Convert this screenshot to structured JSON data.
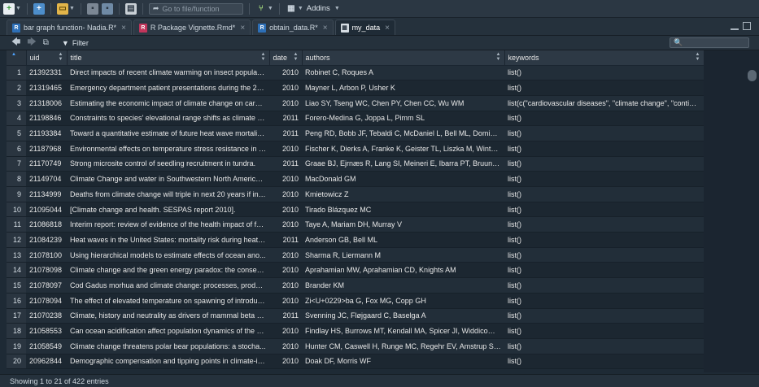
{
  "toolbar": {
    "goto_placeholder": "Go to file/function",
    "addins_label": "Addins"
  },
  "tabs": [
    {
      "label": "bar graph function- Nadia.R*",
      "icon": "r-script-icon",
      "active": false
    },
    {
      "label": "R Package Vignette.Rmd*",
      "icon": "rmarkdown-icon",
      "active": false
    },
    {
      "label": "obtain_data.R*",
      "icon": "r-script-icon",
      "active": false
    },
    {
      "label": "my_data",
      "icon": "table-icon",
      "active": true
    }
  ],
  "viewer": {
    "filter_label": "Filter",
    "search_placeholder": ""
  },
  "columns": [
    "uid",
    "title",
    "date",
    "authors",
    "keywords"
  ],
  "rows": [
    {
      "n": "1",
      "uid": "21392331",
      "title": "Direct impacts of recent climate warming on insect populati...",
      "date": "2010",
      "authors": "Robinet C, Roques A",
      "keywords": "list()"
    },
    {
      "n": "2",
      "uid": "21319465",
      "title": "Emergency department patient presentations during the 20...",
      "date": "2010",
      "authors": "Mayner L, Arbon P, Usher K",
      "keywords": "list()"
    },
    {
      "n": "3",
      "uid": "21318006",
      "title": "Estimating the economic impact of climate change on cardi...",
      "date": "2010",
      "authors": "Liao SY, Tseng WC, Chen PY, Chen CC, Wu WM",
      "keywords": "list(c(\"cardiovascular diseases\", \"climate change\", \"contingen..."
    },
    {
      "n": "4",
      "uid": "21198846",
      "title": "Constraints to species' elevational range shifts as climate ch...",
      "date": "2011",
      "authors": "Forero-Medina G, Joppa L, Pimm SL",
      "keywords": "list()"
    },
    {
      "n": "5",
      "uid": "21193384",
      "title": "Toward a quantitative estimate of future heat wave mortality...",
      "date": "2011",
      "authors": "Peng RD, Bobb JF, Tebaldi C, McDaniel L, Bell ML, Dominici F",
      "keywords": "list()"
    },
    {
      "n": "6",
      "uid": "21187968",
      "title": "Environmental effects on temperature stress resistance in th...",
      "date": "2010",
      "authors": "Fischer K, Dierks A, Franke K, Geister TL, Liszka M, Winter S, ...",
      "keywords": "list()"
    },
    {
      "n": "7",
      "uid": "21170749",
      "title": "Strong microsite control of seedling recruitment in tundra.",
      "date": "2011",
      "authors": "Graae BJ, Ejrnæs R, Lang SI, Meineri E, Ibarra PT, Bruun HH",
      "keywords": "list()"
    },
    {
      "n": "8",
      "uid": "21149704",
      "title": "Climate Change and water in Southwestern North America s...",
      "date": "2010",
      "authors": "MacDonald GM",
      "keywords": "list()"
    },
    {
      "n": "9",
      "uid": "21134999",
      "title": "Deaths from climate change will triple in next 20 years if ina...",
      "date": "2010",
      "authors": "Kmietowicz Z",
      "keywords": "list()"
    },
    {
      "n": "10",
      "uid": "21095044",
      "title": "[Climate change and health. SESPAS report 2010].",
      "date": "2010",
      "authors": "Tirado Blázquez MC",
      "keywords": "list()"
    },
    {
      "n": "11",
      "uid": "21086818",
      "title": "Interim report: review of evidence of the health impact of fa...",
      "date": "2010",
      "authors": "Taye A, Mariam DH, Murray V",
      "keywords": "list()"
    },
    {
      "n": "12",
      "uid": "21084239",
      "title": "Heat waves in the United States: mortality risk during heat w...",
      "date": "2011",
      "authors": "Anderson GB, Bell ML",
      "keywords": "list()"
    },
    {
      "n": "13",
      "uid": "21078100",
      "title": "Using hierarchical models to estimate effects of ocean ano...",
      "date": "2010",
      "authors": "Sharma R, Liermann M",
      "keywords": "list()"
    },
    {
      "n": "14",
      "uid": "21078098",
      "title": "Climate change and the green energy paradox: the consequ...",
      "date": "2010",
      "authors": "Aprahamian MW, Aprahamian CD, Knights AM",
      "keywords": "list()"
    },
    {
      "n": "15",
      "uid": "21078097",
      "title": "Cod Gadus morhua and climate change: processes, product...",
      "date": "2010",
      "authors": "Brander KM",
      "keywords": "list()"
    },
    {
      "n": "16",
      "uid": "21078094",
      "title": "The effect of elevated temperature on spawning of introduc...",
      "date": "2010",
      "authors": "Zi<U+0229>ba G, Fox MG, Copp GH",
      "keywords": "list()"
    },
    {
      "n": "17",
      "uid": "21070238",
      "title": "Climate, history and neutrality as drivers of mammal beta di...",
      "date": "2011",
      "authors": "Svenning JC, Fløjgaard C, Baselga A",
      "keywords": "list()"
    },
    {
      "n": "18",
      "uid": "21058553",
      "title": "Can ocean acidification affect population dynamics of the b...",
      "date": "2010",
      "authors": "Findlay HS, Burrows MT, Kendall MA, Spicer JI, Widdicombe S",
      "keywords": "list()"
    },
    {
      "n": "19",
      "uid": "21058549",
      "title": "Climate change threatens polar bear populations: a stocha...",
      "date": "2010",
      "authors": "Hunter CM, Caswell H, Runge MC, Regehr EV, Amstrup SC, S...",
      "keywords": "list()"
    },
    {
      "n": "20",
      "uid": "20962844",
      "title": "Demographic compensation and tipping points in climate-in...",
      "date": "2010",
      "authors": "Doak DF, Morris WF",
      "keywords": "list()"
    }
  ],
  "status": {
    "text": "Showing 1 to 21 of 422 entries"
  }
}
